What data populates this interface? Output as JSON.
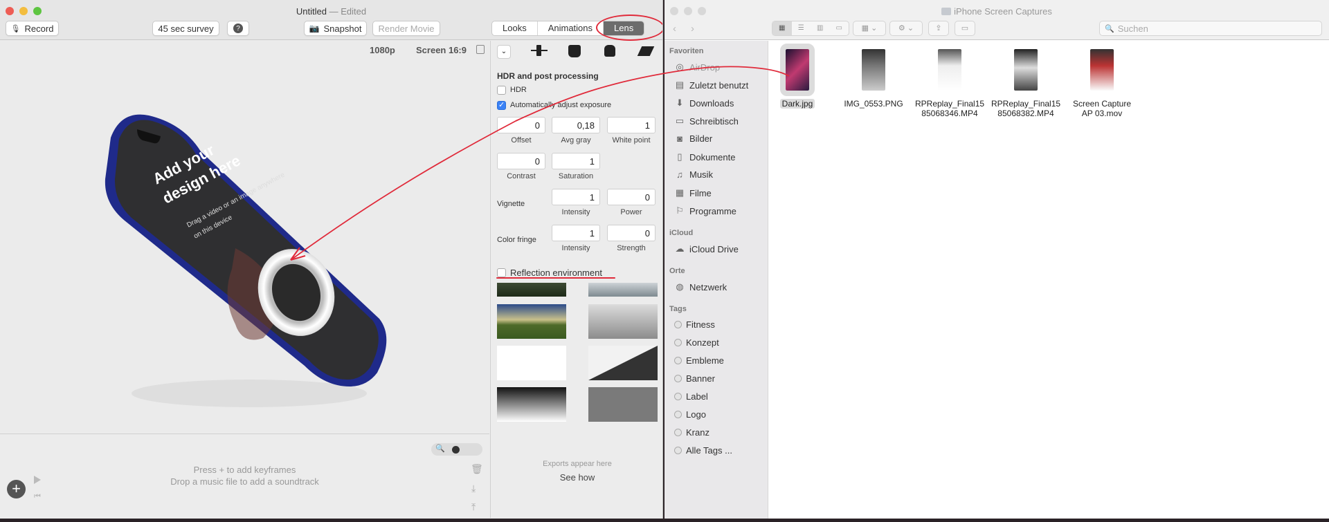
{
  "left_app": {
    "title": "Untitled",
    "title_suffix": "— Edited",
    "toolbar": {
      "record": "Record",
      "survey": "45 sec survey",
      "help": "?",
      "snapshot": "Snapshot",
      "render": "Render Movie",
      "tabs": [
        "Looks",
        "Animations",
        "Lens"
      ],
      "selected_tab": "Lens"
    },
    "canvas": {
      "resolution": "1080p",
      "screen": "Screen 16:9",
      "phone_text_title": "Add your design here",
      "phone_text_sub": "Drag a video or an image anywhere on this device"
    },
    "lens": {
      "section_title": "HDR and post processing",
      "hdr_label": "HDR",
      "hdr_checked": false,
      "auto_label": "Automatically adjust exposure",
      "auto_checked": true,
      "offset": "0",
      "offset_label": "Offset",
      "avg_gray": "0,18",
      "avg_gray_label": "Avg gray",
      "white_point": "1",
      "white_point_label": "White point",
      "contrast": "0",
      "contrast_label": "Contrast",
      "saturation": "1",
      "saturation_label": "Saturation",
      "vignette_label": "Vignette",
      "vig_intensity": "1",
      "vig_intensity_label": "Intensity",
      "vig_power": "0",
      "vig_power_label": "Power",
      "fringe_label": "Color fringe",
      "fringe_intensity": "1",
      "fringe_intensity_label": "Intensity",
      "fringe_strength": "0",
      "fringe_strength_label": "Strength",
      "reflection_label": "Reflection environment",
      "reflection_checked": false
    },
    "timeline": {
      "hint1": "Press + to add keyframes",
      "hint2": "Drop a music file to add a soundtrack"
    },
    "exports": {
      "hint": "Exports appear here",
      "link": "See how"
    }
  },
  "finder": {
    "title": "iPhone Screen Captures",
    "search_placeholder": "Suchen",
    "favorites_header": "Favoriten",
    "favorites": [
      {
        "label": "AirDrop",
        "icon": "airdrop-icon"
      },
      {
        "label": "Zuletzt benutzt",
        "icon": "recents-icon"
      },
      {
        "label": "Downloads",
        "icon": "downloads-icon"
      },
      {
        "label": "Schreibtisch",
        "icon": "desktop-icon"
      },
      {
        "label": "Bilder",
        "icon": "pictures-icon"
      },
      {
        "label": "Dokumente",
        "icon": "documents-icon"
      },
      {
        "label": "Musik",
        "icon": "music-icon"
      },
      {
        "label": "Filme",
        "icon": "movies-icon"
      },
      {
        "label": "Programme",
        "icon": "applications-icon"
      }
    ],
    "icloud_header": "iCloud",
    "icloud": [
      {
        "label": "iCloud Drive",
        "icon": "cloud-icon"
      }
    ],
    "places_header": "Orte",
    "places": [
      {
        "label": "Netzwerk",
        "icon": "network-icon"
      }
    ],
    "tags_header": "Tags",
    "tags": [
      "Fitness",
      "Konzept",
      "Embleme",
      "Banner",
      "Label",
      "Logo",
      "Kranz",
      "Alle Tags ..."
    ],
    "files": [
      {
        "line1": "Dark.jpg",
        "line2": "",
        "selected": true
      },
      {
        "line1": "IMG_0553.PNG",
        "line2": "",
        "selected": false
      },
      {
        "line1": "RPReplay_Final15",
        "line2": "85068346.MP4",
        "selected": false
      },
      {
        "line1": "RPReplay_Final15",
        "line2": "85068382.MP4",
        "selected": false
      },
      {
        "line1": "Screen Capture",
        "line2": "AP 03.mov",
        "selected": false
      }
    ]
  },
  "colors": {
    "annotation_red": "#e02a3a",
    "checkbox_blue": "#3b82f6",
    "phone_blue": "#1f2a8a",
    "screen_dark": "#2f2f31"
  }
}
